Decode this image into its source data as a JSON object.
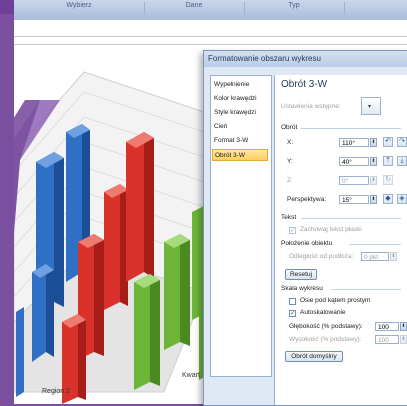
{
  "ribbon": {
    "columns": [
      "Wybierz",
      "Dane",
      "Typ",
      ""
    ]
  },
  "chart": {
    "region_label": "Region 2",
    "axis_label": "Kwart"
  },
  "dialog": {
    "title": "Formatowanie obszaru wykresu",
    "nav_items": [
      "Wypełnienie",
      "Kolor krawędzi",
      "Style krawędzi",
      "Cień",
      "Format 3-W",
      "Obrót 3-W"
    ],
    "selected_nav": "Obrót 3-W",
    "panel": {
      "heading": "Obrót 3-W",
      "presets_label": "Ustawienia wstępne:",
      "rotation_section": "Obrót",
      "x_label": "X:",
      "x_value": "110°",
      "y_label": "Y:",
      "y_value": "40°",
      "z_label": "Z:",
      "z_value": "0°",
      "perspective_label": "Perspektywa:",
      "perspective_value": "15°",
      "text_section": "Tekst",
      "keep_text_flat": "Zachowaj tekst płaski",
      "object_position_section": "Położenie obiektu",
      "distance_label": "Odległość od podłoża:",
      "distance_value": "0 pkt",
      "reset_button": "Resetuj",
      "chart_scale_section": "Skala wykresu",
      "right_angle_axes": "Osie pod kątem prostym",
      "autoscale": "Autoskalowanie",
      "depth_label": "Głębokość (% podstawy):",
      "depth_value": "100",
      "height_label": "Wysokość (% podstawy):",
      "height_value": "100",
      "default_rotation_button": "Obrót domyślny"
    }
  },
  "colors": {
    "frame": "#6f3f97",
    "bar_blue": "#2f6fc4",
    "bar_red": "#d8322a",
    "bar_green": "#6cb536",
    "selected_nav": "#ffcf5b"
  }
}
